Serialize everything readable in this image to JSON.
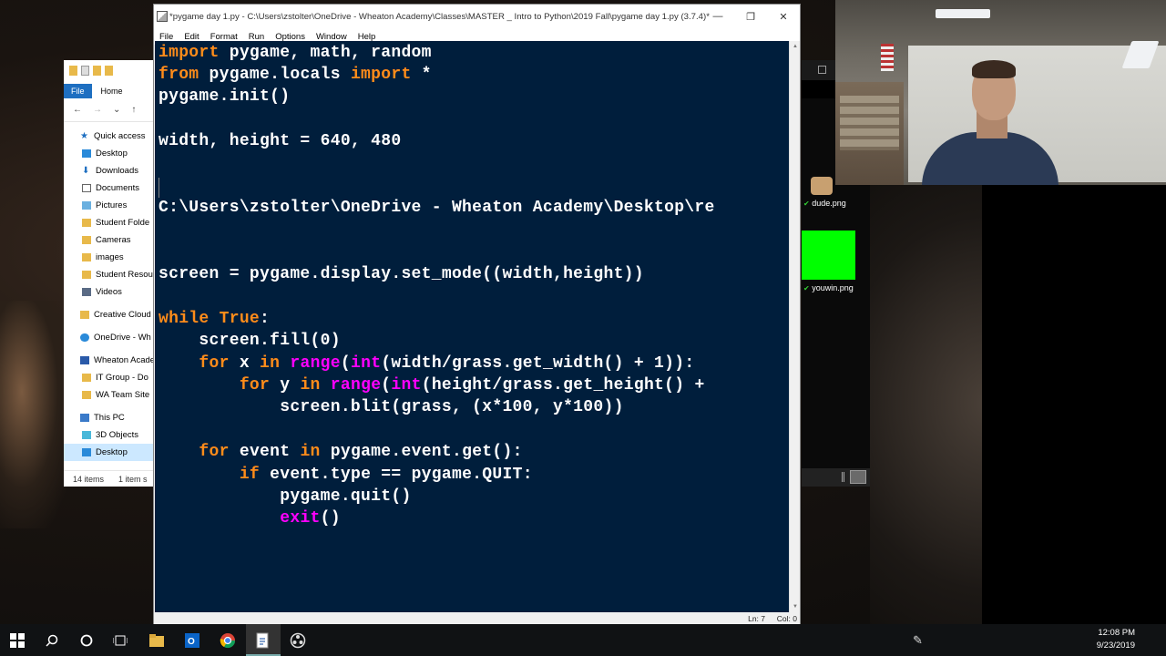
{
  "idle": {
    "title": "*pygame day 1.py - C:\\Users\\zstolter\\OneDrive - Wheaton Academy\\Classes\\MASTER _ Intro to Python\\2019 Fall\\pygame day 1.py (3.7.4)*",
    "menu": [
      "File",
      "Edit",
      "Format",
      "Run",
      "Options",
      "Window",
      "Help"
    ],
    "status_ln": "Ln: 7",
    "status_col": "Col: 0"
  },
  "code": {
    "l1a": "import",
    "l1b": " pygame, math, random",
    "l2a": "from",
    "l2b": " pygame.locals ",
    "l2c": "import",
    "l2d": " *",
    "l3": "pygame.init()",
    "l4": "width, height = 640, 480",
    "l5": "C:\\Users\\zstolter\\OneDrive - Wheaton Academy\\Desktop\\re",
    "l6": "screen = pygame.display.set_mode((width,height))",
    "l7a": "while",
    "l7b": " ",
    "l7c": "True",
    "l7d": ":",
    "l8": "    screen.fill(0)",
    "l9a": "    ",
    "l9b": "for",
    "l9c": " x ",
    "l9d": "in",
    "l9e": " ",
    "l9f": "range",
    "l9g": "(",
    "l9h": "int",
    "l9i": "(width/grass.get_width() + 1)):",
    "l10a": "        ",
    "l10b": "for",
    "l10c": " y ",
    "l10d": "in",
    "l10e": " ",
    "l10f": "range",
    "l10g": "(",
    "l10h": "int",
    "l10i": "(height/grass.get_height() +",
    "l11": "            screen.blit(grass, (x*100, y*100))",
    "l12a": "    ",
    "l12b": "for",
    "l12c": " event ",
    "l12d": "in",
    "l12e": " pygame.event.get():",
    "l13a": "        ",
    "l13b": "if",
    "l13c": " event.type == pygame.QUIT:",
    "l14": "            pygame.quit()",
    "l15a": "            ",
    "l15b": "exit",
    "l15c": "()"
  },
  "explorer": {
    "tab_file": "File",
    "tab_home": "Home",
    "tree": [
      {
        "label": "Quick access",
        "icon": "star-icon"
      },
      {
        "label": "Desktop",
        "icon": "folder-blue-icon"
      },
      {
        "label": "Downloads",
        "icon": "download-icon"
      },
      {
        "label": "Documents",
        "icon": "document-icon"
      },
      {
        "label": "Pictures",
        "icon": "pictures-icon"
      },
      {
        "label": "Student Folde",
        "icon": "folder-icon"
      },
      {
        "label": "Cameras",
        "icon": "folder-icon"
      },
      {
        "label": "images",
        "icon": "folder-icon"
      },
      {
        "label": "Student Resou",
        "icon": "folder-icon"
      },
      {
        "label": "Videos",
        "icon": "video-icon"
      },
      {
        "label": "Creative Cloud",
        "icon": "folder-icon"
      },
      {
        "label": "OneDrive - Wh",
        "icon": "cloud-icon"
      },
      {
        "label": "Wheaton Acade",
        "icon": "building-icon"
      },
      {
        "label": "IT Group - Do",
        "icon": "folder-icon"
      },
      {
        "label": "WA Team Site",
        "icon": "folder-icon"
      },
      {
        "label": "This PC",
        "icon": "computer-icon"
      },
      {
        "label": "3D Objects",
        "icon": "cube-icon"
      },
      {
        "label": "Desktop",
        "icon": "folder-blue-icon"
      }
    ],
    "status_items": "14 items",
    "status_selected": "1 item s"
  },
  "files": {
    "dude": "dude.png",
    "youwin": "youwin.png"
  },
  "clock": {
    "time": "12:08 PM",
    "date": "9/23/2019"
  }
}
